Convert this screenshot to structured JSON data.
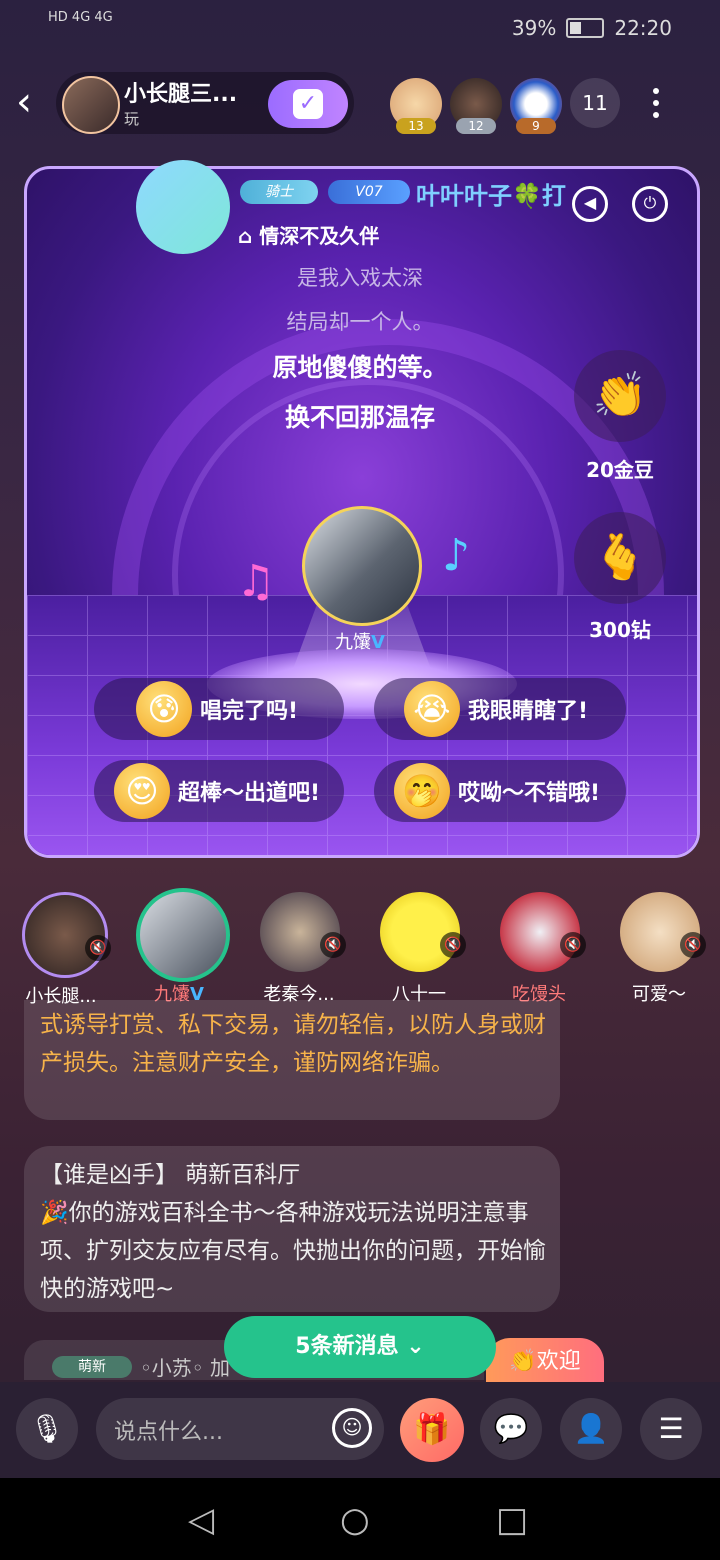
{
  "status_bar": {
    "network": "HD 4G 4G",
    "battery": "39%",
    "time": "22:20",
    "battery_level": 0.39
  },
  "header": {
    "room_title": "小长腿三...",
    "room_sub": "玩",
    "online_count": "11",
    "ranks": [
      {
        "badge": "13"
      },
      {
        "badge": "12"
      },
      {
        "badge": "9"
      }
    ]
  },
  "stage": {
    "knight_tag": "骑士",
    "vip_tag": "V07",
    "singer_name": "叶叶叶子🍀打",
    "song_title": "情深不及久伴",
    "lyrics_prev": [
      "是我入戏太深",
      "结局却一个人。"
    ],
    "lyrics_current": [
      "原地傻傻的等。",
      "换不回那温存"
    ],
    "gift1_label": "20金豆",
    "gift2_label": "300钻",
    "performer_name": "九馕",
    "performer_verified": "V",
    "reactions": [
      "唱完了吗!",
      "我眼睛瞎了!",
      "超棒～出道吧!",
      "哎呦～不错哦!"
    ]
  },
  "seats": [
    {
      "name": "小长腿..."
    },
    {
      "name": "九馕",
      "verified": "V"
    },
    {
      "name": "老秦今..."
    },
    {
      "name": "八十一"
    },
    {
      "name": "吃馒头"
    },
    {
      "name": "可爱～"
    }
  ],
  "chat": {
    "warning_text": "式诱导打赏、私下交易，请勿轻信，以防人身或财产损失。注意财产安全，谨防网络诈骗。",
    "info_text": "【谁是凶手】 萌新百科厅\n🎉你的游戏百科全书～各种游戏玩法说明注意事项、扩列交友应有尽有。快抛出你的问题，开始愉快的游戏吧~",
    "newbie_tag": "萌新",
    "newbie_name": "◦小苏◦ 加",
    "new_messages": "5条新消息",
    "welcome": "👏欢迎"
  },
  "input": {
    "placeholder": "说点什么..."
  },
  "colors": {
    "accent_green": "#25c38c",
    "warning": "#f7b34a",
    "stage_border": "#c9a7ff",
    "vip_blue": "#49b6ff"
  }
}
